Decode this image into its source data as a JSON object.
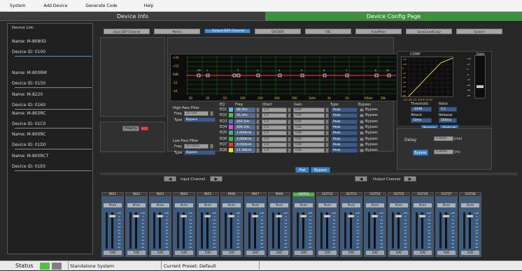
{
  "menu": {
    "items": [
      "System",
      "Add Device",
      "Generate Code",
      "Help"
    ]
  },
  "header": {
    "left_title": "Device Info",
    "right_title": "Device Config Page"
  },
  "devices": {
    "title": "Device List:",
    "items": [
      {
        "name": "Name: M-8080D",
        "id": "Device ID: 0100"
      },
      {
        "name": "Name: M-800RM",
        "id": "Device ID: 0150"
      },
      {
        "name": "Name: M-8220",
        "id": "Device ID: 0160"
      },
      {
        "name": "Name: M-802RC",
        "id": "Device ID: 01C0"
      },
      {
        "name": "Name: M-800RC",
        "id": "Device ID: 01D0"
      },
      {
        "name": "Name: M-800RCT",
        "id": "Device ID: 01E0"
      }
    ]
  },
  "tabs": [
    "Input DSP Channel",
    "Matrix",
    "Output DSP Channel",
    "DUCKER",
    "FBC",
    "AutoMixer",
    "Save/Load/Copy",
    "System"
  ],
  "selected_tab": "Output DSP Channel",
  "eq_graph": {
    "y_labels": [
      "+24",
      "+12",
      "0dB",
      "-12",
      "-24"
    ],
    "x_labels": [
      "20",
      "30",
      "50",
      "100",
      "200",
      "300",
      "500",
      "1kHz",
      "2k",
      "5k",
      "10kHz",
      "20k"
    ],
    "markers": [
      "HP",
      "1",
      "2",
      "3",
      "4",
      "5",
      "6",
      "7",
      "8",
      "LP"
    ]
  },
  "hpf": {
    "title": "High Pass Filter",
    "freq_label": "Freq",
    "freq": "20.1Hz",
    "type_label": "Type",
    "type": "Bypass"
  },
  "lpf": {
    "title": "Low Pass Filter",
    "freq_label": "Freq",
    "freq": "20.1KHz",
    "type_label": "Type",
    "type": "Bypass"
  },
  "polarity": "Polarity",
  "eq_headers": [
    "EQ",
    "Freq",
    "Qfact",
    "Gain",
    "Type",
    "Bypass"
  ],
  "eq_rows": [
    {
      "label": "EQ1",
      "freq": "88.3Hz",
      "q": "2.0",
      "gain": "0dB",
      "type": "Peak",
      "bypass": "Bypass",
      "color": "#5cb8f0"
    },
    {
      "label": "EQ2",
      "freq": "95.2Hz",
      "q": "2.0",
      "gain": "0dB",
      "type": "Peak",
      "bypass": "Bypass",
      "color": "#4ac34a"
    },
    {
      "label": "EQ3",
      "freq": "203.1Hz",
      "q": "2.0",
      "gain": "0dB",
      "type": "Peak",
      "bypass": "Bypass",
      "color": "#4a7ad8"
    },
    {
      "label": "EQ4",
      "freq": "406.1Hz",
      "q": "2.0",
      "gain": "0dB",
      "type": "Peak",
      "bypass": "Bypass",
      "color": "#e04ad8"
    },
    {
      "label": "EQ5",
      "freq": "1.000kHz",
      "q": "2.0",
      "gain": "0dB",
      "type": "Peak",
      "bypass": "Bypass",
      "color": "#2ab8a0"
    },
    {
      "label": "EQ6",
      "freq": "2.000kHz",
      "q": "2.0",
      "gain": "0dB",
      "type": "Peak",
      "bypass": "Bypass",
      "color": "#3ab84a"
    },
    {
      "label": "EQ7",
      "freq": "4.000kHz",
      "q": "2.0",
      "gain": "0dB",
      "type": "Peak",
      "bypass": "Bypass",
      "color": "#d83838"
    },
    {
      "label": "EQ8",
      "freq": "11.38kHz",
      "q": "2.0",
      "gain": "0dB",
      "type": "Peak",
      "bypass": "Bypass",
      "color": "#e8e020"
    }
  ],
  "flat_button": "Flat",
  "bypass_button": "Bypass",
  "comp": {
    "title": "COMP",
    "gain_title": "Gain",
    "threshold_label": "Threshold",
    "threshold": "-30dB",
    "ratio_label": "Ratio",
    "ratio": "1:1",
    "attack_label": "Attack",
    "attack": "50ms",
    "release_label": "Release",
    "release": "500ms",
    "bypass_button": "Bypass",
    "default_button": "Default",
    "y_labels": [
      "+20",
      "+10",
      "0",
      "-10",
      "-20",
      "-30",
      "-40",
      "-50",
      "-60"
    ],
    "x_labels": "-24  -18  -12  -6   0   6  12  20",
    "gain_scale": [
      "+12",
      "+6",
      "0",
      "-6",
      "-12",
      "-20",
      "-40",
      "-60"
    ]
  },
  "delay": {
    "label": "Delay",
    "value": "0.0000",
    "unit": "(ms)",
    "bypass_button": "Bypass",
    "value2": "0.0000",
    "unit2": "(m)"
  },
  "input_header": "Input Channel",
  "output_header": "Output Channel",
  "inputs": [
    "IN01",
    "IN02",
    "IN03",
    "IN04",
    "IN05",
    "IN06",
    "IN07",
    "IN08"
  ],
  "outputs": [
    "OUT01",
    "OUT02",
    "OUT03",
    "OUT04",
    "OUT05",
    "OUT06",
    "OUT07",
    "OUT08"
  ],
  "mute_label": "Mute",
  "level_label": "0dB",
  "out07_level": "0dB",
  "fader_scale": [
    "0dB",
    "-5",
    "-10",
    "-15",
    "-20",
    "-25",
    "-30",
    "-40",
    "-50",
    "-60",
    "-80",
    "-inf"
  ],
  "status": {
    "label": "Status",
    "mode": "Standalone System",
    "preset": "Current Preset: Default",
    "status_colors": [
      "#55c044",
      "#808080"
    ]
  }
}
